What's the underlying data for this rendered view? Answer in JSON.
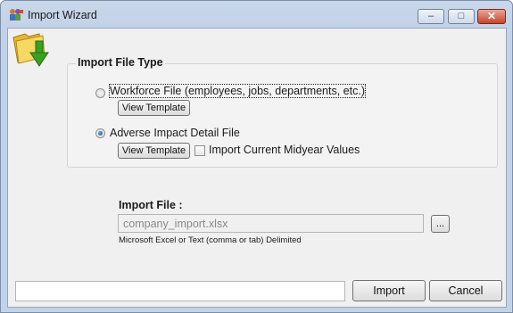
{
  "window": {
    "title": "Import Wizard",
    "caption_buttons": {
      "minimize": "–",
      "maximize": "□",
      "close": "✕"
    }
  },
  "file_type_group": {
    "title": "Import File Type",
    "options": [
      {
        "label": "Workforce File (employees, jobs, departments, etc.)",
        "checked": false,
        "view_template": "View Template"
      },
      {
        "label": "Adverse Impact Detail File",
        "checked": true,
        "view_template": "View Template"
      }
    ],
    "midyear_checkbox": {
      "label": "Import Current Midyear Values",
      "checked": false
    }
  },
  "import_file": {
    "title": "Import File :",
    "value": "company_import.xlsx",
    "browse_label": "...",
    "hint": "Microsoft Excel or Text (comma or tab) Delimited"
  },
  "footer": {
    "status_text": "",
    "import_label": "Import",
    "cancel_label": "Cancel"
  },
  "icons": {
    "app": "import-wizard-app-icon",
    "folder": "folder-import-icon"
  },
  "colors": {
    "accent_green": "#3aa023",
    "folder_yellow": "#f2cd4a",
    "close_red": "#c7452c"
  }
}
